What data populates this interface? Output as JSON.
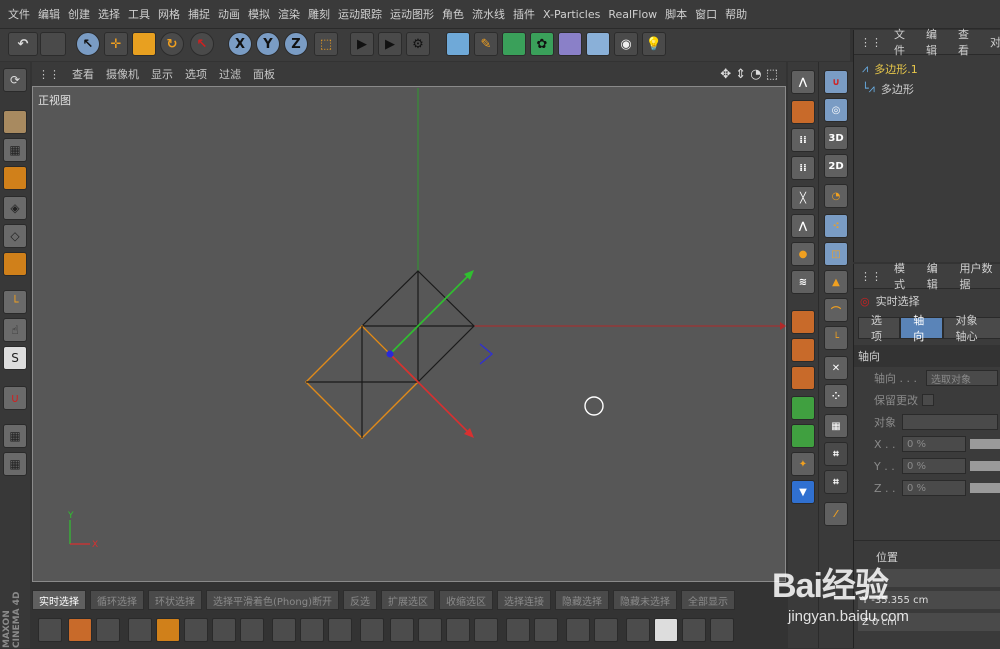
{
  "menu": [
    "文件",
    "编辑",
    "创建",
    "选择",
    "工具",
    "网格",
    "捕捉",
    "动画",
    "模拟",
    "渲染",
    "雕刻",
    "运动跟踪",
    "运动图形",
    "角色",
    "流水线",
    "插件",
    "X-Particles",
    "RealFlow",
    "脚本",
    "窗口",
    "帮助"
  ],
  "toolbar": {
    "axis_x": "X",
    "axis_y": "Y",
    "axis_z": "Z"
  },
  "viewport": {
    "menu": [
      "查看",
      "摄像机",
      "显示",
      "选项",
      "过滤",
      "面板"
    ],
    "label": "正视图",
    "axis_x": "X",
    "axis_y": "Y"
  },
  "right_tools": {
    "label_3d": "3D",
    "label_2d": "2D"
  },
  "objects": {
    "menu": [
      "文件",
      "编辑",
      "查看",
      "对"
    ],
    "items": [
      "多边形.1",
      "多边形"
    ]
  },
  "attributes": {
    "menu": [
      "模式",
      "编辑",
      "用户数据"
    ],
    "title": "实时选择",
    "tabs": [
      "选项",
      "轴向",
      "对象轴心"
    ],
    "section": "轴向",
    "axis_label": "轴向 . . .",
    "axis_value": "选取对象",
    "keep_changes": "保留更改",
    "object_label": "对象",
    "x_label": "X . .",
    "x_value": "0 %",
    "y_label": "Y . .",
    "y_value": "0 %",
    "z_label": "Z . .",
    "z_value": "0 %",
    "position": "位置",
    "pos_y": "Y  -35.355 cm",
    "pos_z": "Z  0 cm"
  },
  "selection_modes": [
    "实时选择",
    "循环选择",
    "环状选择",
    "选择平滑着色(Phong)断开",
    "反选",
    "扩展选区",
    "收缩选区",
    "选择连接",
    "隐藏选择",
    "隐藏未选择",
    "全部显示"
  ],
  "brand": "MAXON CINEMA 4D",
  "watermark": {
    "logo": "Bai经验",
    "url": "jingyan.baidu.com"
  },
  "colors": {
    "viewport_bg": "#575757",
    "accent_blue": "#5a84b8",
    "object_highlight": "#e8c84a"
  }
}
